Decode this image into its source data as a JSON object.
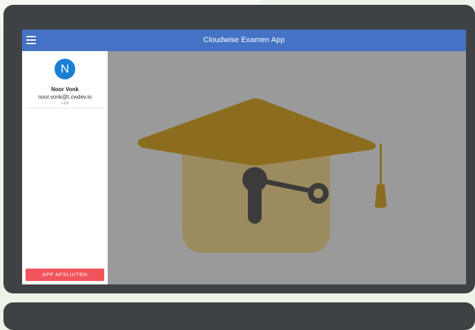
{
  "appbar": {
    "title": "Cloudwise Examen App",
    "menu_icon": "hamburger-menu-icon"
  },
  "drawer": {
    "avatar_initial": "N",
    "user_name": "Noor Vonk",
    "user_email": "noor.vonk@t.cwdev.io",
    "version": "1.0.0",
    "exit_label": "APP AFSLUITEN"
  },
  "logo": {
    "icon": "graduation-cap-key-icon",
    "colors": {
      "cap": "#8c6d1f",
      "body": "#9d8b60",
      "key": "#3b3b3b",
      "tassel": "#8c6d1f"
    }
  },
  "colors": {
    "appbar": "#4472c4",
    "exit_button": "#f2545b",
    "avatar": "#1a7fd4",
    "overlay": "#9a9a9a",
    "device": "#3e4244"
  }
}
